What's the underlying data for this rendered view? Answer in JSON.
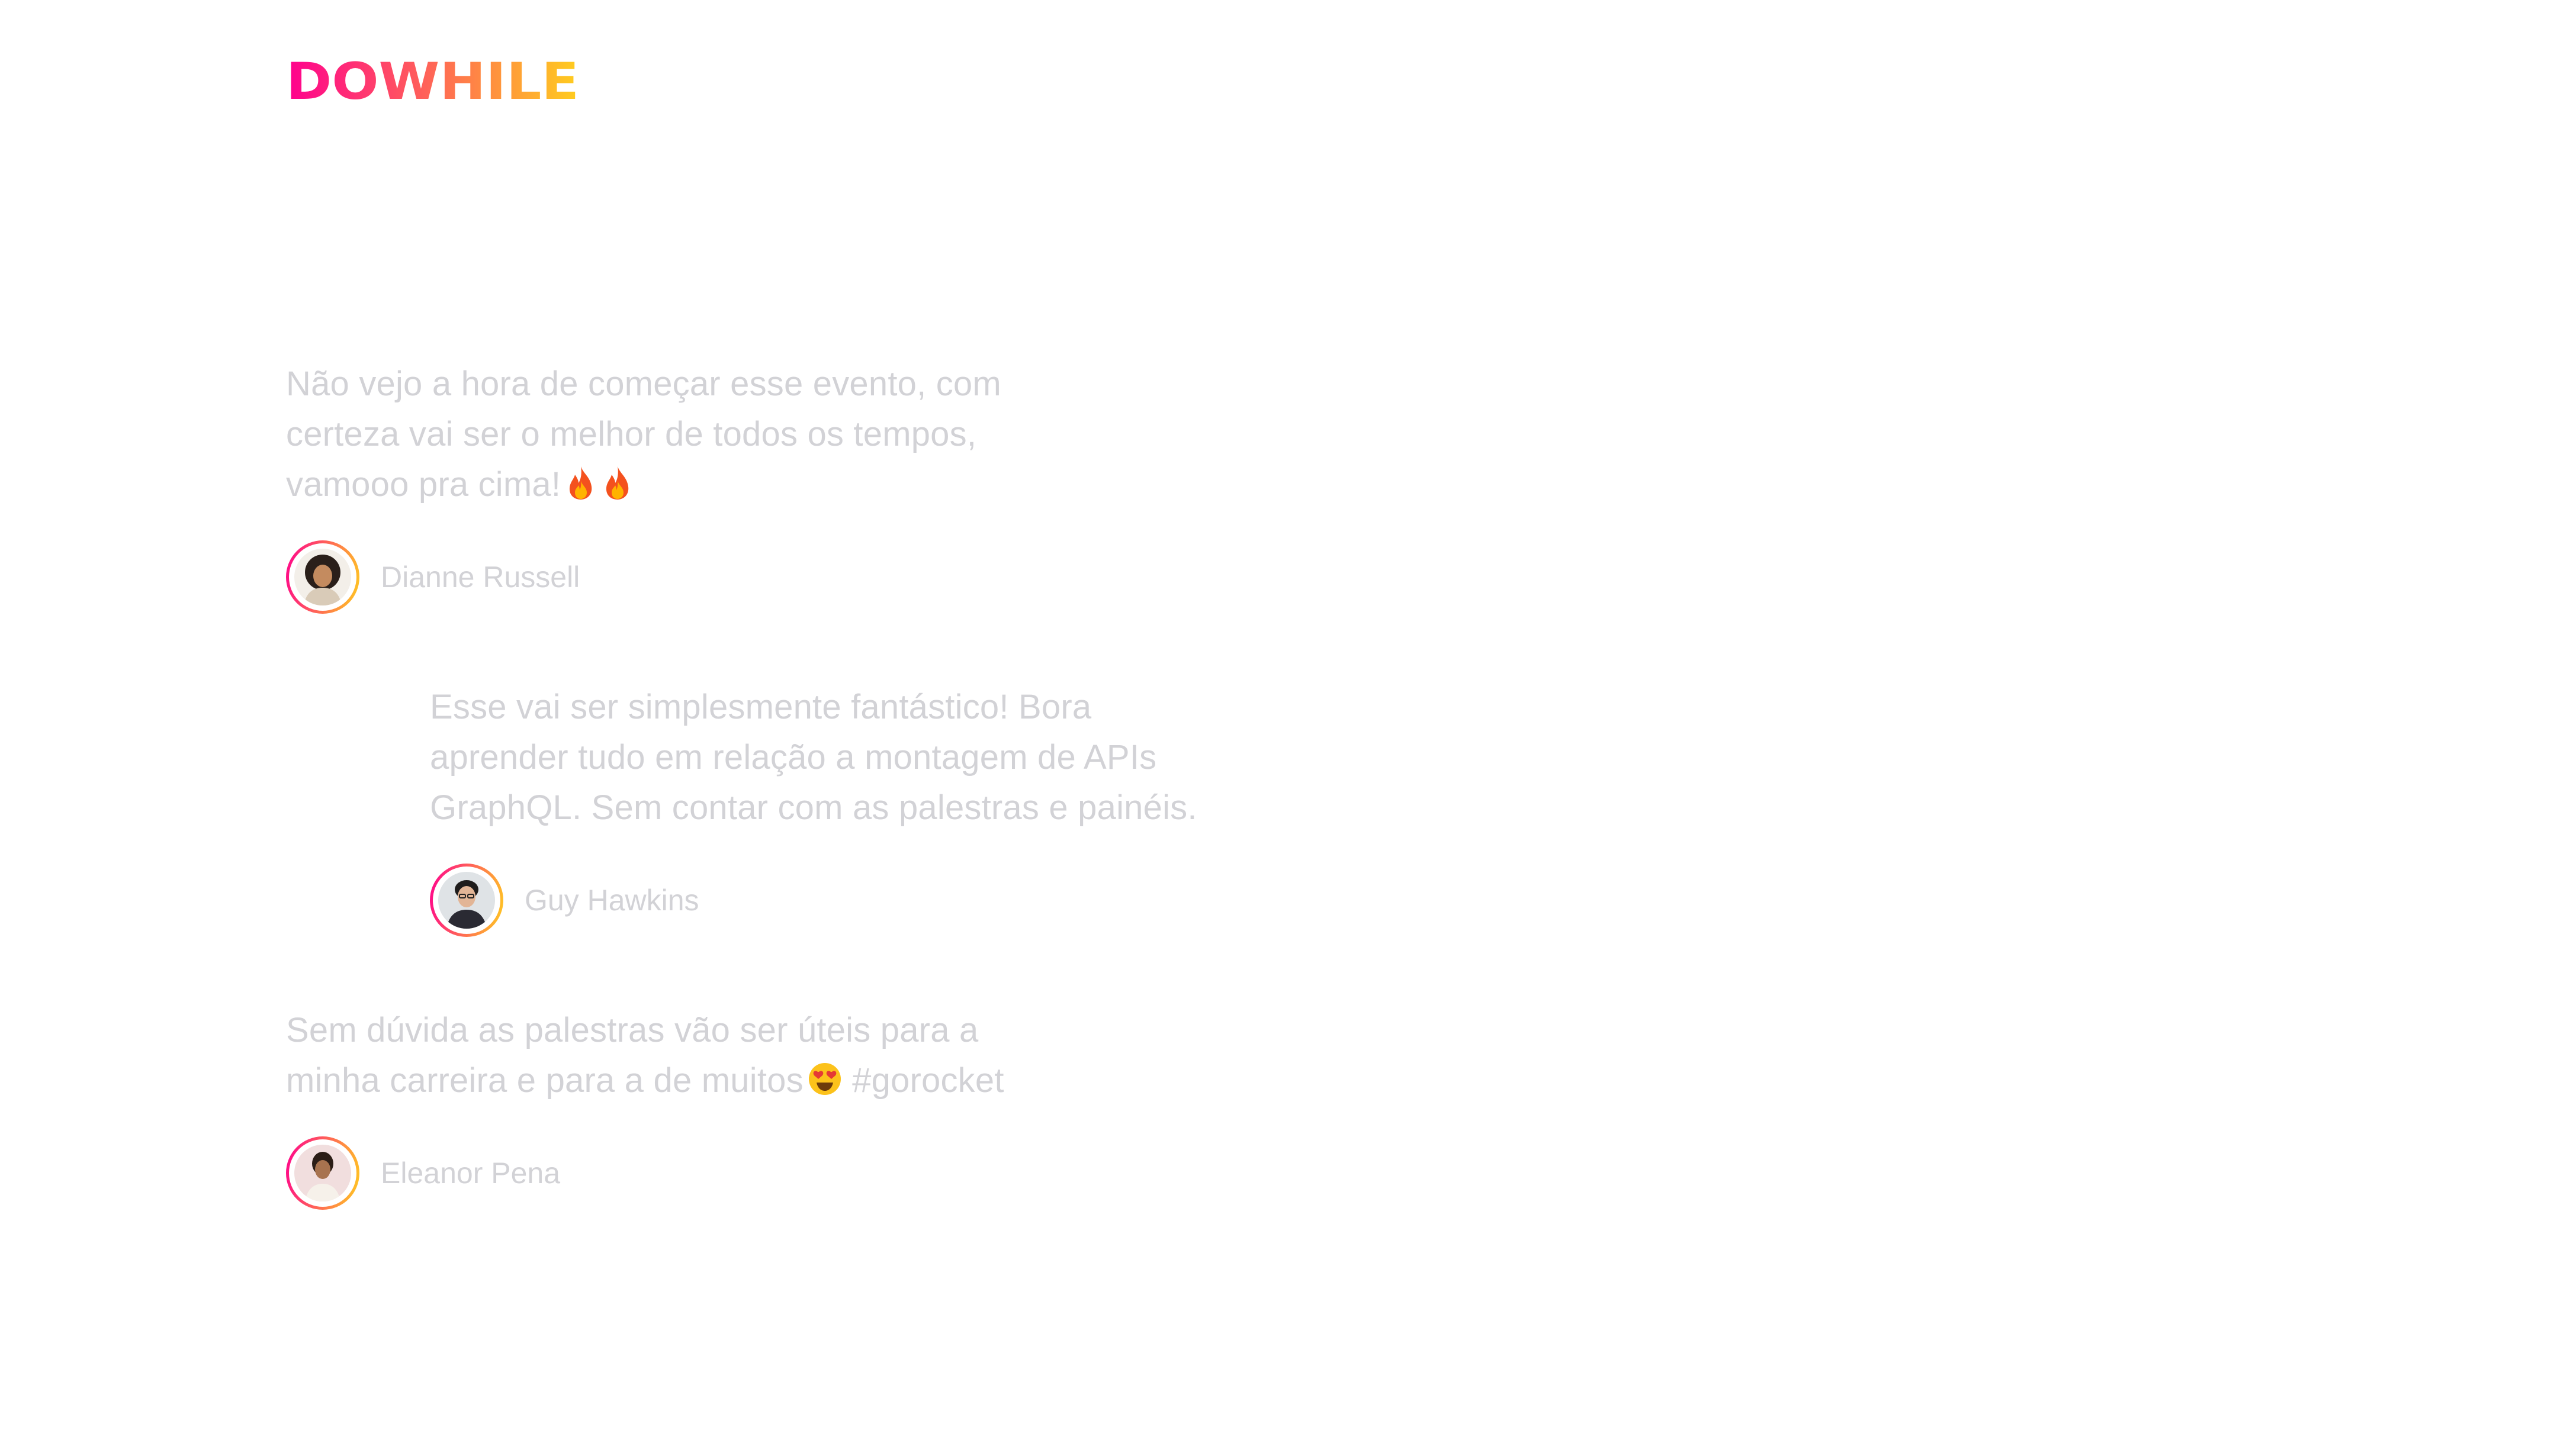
{
  "brand": {
    "logo_text": "DOWHILE",
    "gradient_start": "#ff008e",
    "gradient_end": "#ffcd1e"
  },
  "text_color": "#d2d2d6",
  "messages": [
    {
      "text": "Não vejo a hora de começar esse evento, com certeza vai ser o melhor de todos os tempos, vamooo pra cima!",
      "emojis": [
        "fire-emoji",
        "fire-emoji"
      ],
      "author": "Dianne Russell",
      "avatar_icon": "avatar-photo"
    },
    {
      "text": "Esse vai ser simplesmente fantástico! Bora aprender tudo em relação a montagem de APIs GraphQL. Sem contar com as palestras e painéis.",
      "emojis": [],
      "author": "Guy Hawkins",
      "avatar_icon": "avatar-photo"
    },
    {
      "text": "Sem dúvida as palestras vão ser úteis para a minha carreira e para a de muitos",
      "emojis": [
        "heart-eyes-emoji"
      ],
      "text_after_emoji": "#gorocket",
      "author": "Eleanor Pena",
      "avatar_icon": "avatar-photo"
    }
  ]
}
